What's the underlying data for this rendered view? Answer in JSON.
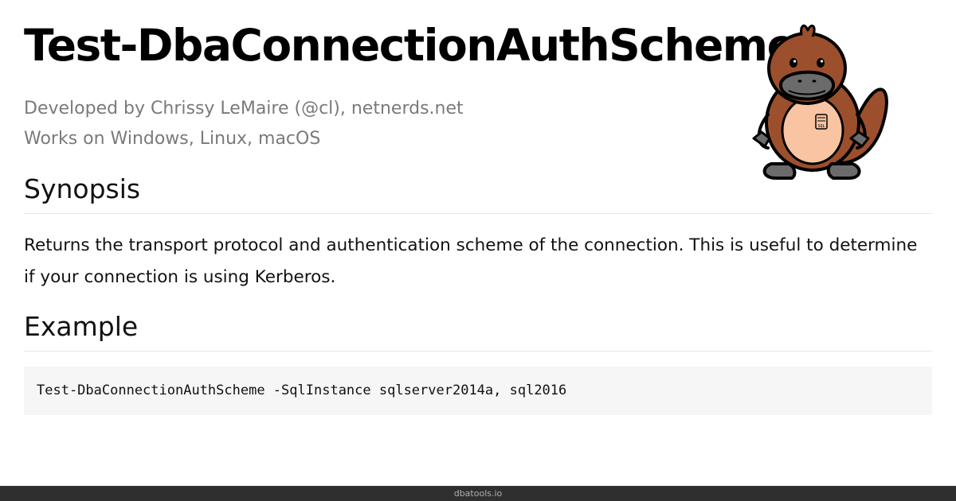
{
  "page": {
    "title": "Test-DbaConnectionAuthScheme",
    "developer_line": "Developed by Chrissy LeMaire (@cl), netnerds.net",
    "platforms_line": "Works on Windows, Linux, macOS"
  },
  "synopsis": {
    "heading": "Synopsis",
    "text": "Returns the transport protocol and authentication scheme of the connection. This is useful to determine if your connection is using Kerberos."
  },
  "example": {
    "heading": "Example",
    "code": "Test-DbaConnectionAuthScheme -SqlInstance sqlserver2014a, sql2016"
  },
  "mascot": {
    "icon": "platypus-mascot-icon",
    "badge_text": "SQL",
    "colors": {
      "body": "#9c4f2c",
      "belly": "#f8c4a2",
      "bill": "#6b6b6b",
      "outline": "#000000"
    }
  },
  "footer": {
    "text": "dbatools.io"
  }
}
